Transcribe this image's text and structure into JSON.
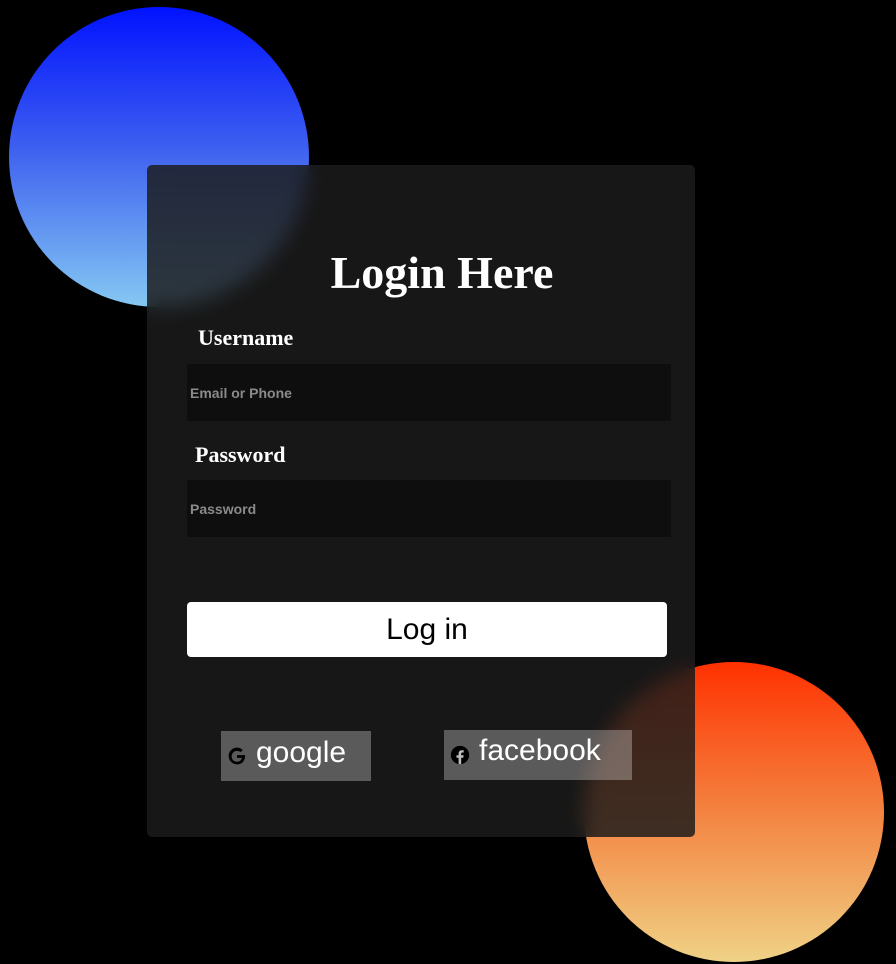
{
  "form": {
    "title": "Login Here",
    "username": {
      "label": "Username",
      "value": "",
      "placeholder": "Email or Phone"
    },
    "password": {
      "label": "Password",
      "value": "",
      "placeholder": "Password"
    },
    "login_label": "Log in"
  },
  "social": {
    "google": {
      "label": "google",
      "icon": "google-icon"
    },
    "facebook": {
      "label": "facebook",
      "icon": "facebook-icon"
    }
  },
  "colors": {
    "background": "#000000",
    "card": "#1c1c1c",
    "input": "#0e0e0e",
    "button": "#ffffff",
    "blue_circle_top": "#0012ff",
    "blue_circle_bottom": "#85c8f2",
    "orange_circle_top": "#ff3100",
    "orange_circle_bottom": "#efd286"
  }
}
